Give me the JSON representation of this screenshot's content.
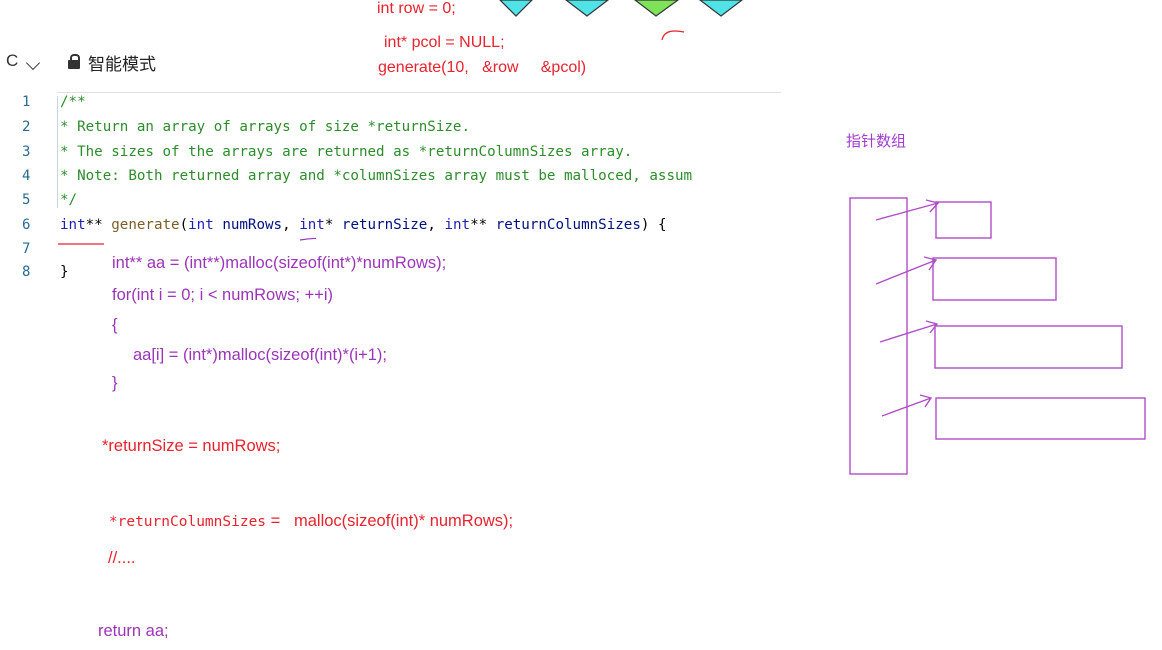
{
  "toolbar": {
    "language_button": "C",
    "mode_label": "智能模式"
  },
  "editor": {
    "line_numbers": [
      "1",
      "2",
      "3",
      "4",
      "5",
      "6",
      "7",
      "8"
    ],
    "lines": [
      {
        "parts": [
          {
            "t": "/**",
            "c": "cm"
          }
        ]
      },
      {
        "parts": [
          {
            "t": " * Return an array of arrays of size *returnSize.",
            "c": "cm"
          }
        ]
      },
      {
        "parts": [
          {
            "t": " * The sizes of the arrays are returned as *returnColumnSizes array.",
            "c": "cm"
          }
        ]
      },
      {
        "parts": [
          {
            "t": " * Note: Both returned array and *columnSizes array must be malloced, assum",
            "c": "cm"
          }
        ]
      },
      {
        "parts": [
          {
            "t": " */",
            "c": "cm"
          }
        ]
      },
      {
        "parts": [
          {
            "t": "int",
            "c": "kw"
          },
          {
            "t": "** ",
            "c": ""
          },
          {
            "t": "generate",
            "c": "fn"
          },
          {
            "t": "(",
            "c": ""
          },
          {
            "t": "int",
            "c": "kw"
          },
          {
            "t": " ",
            "c": ""
          },
          {
            "t": "numRows",
            "c": "pr"
          },
          {
            "t": ", ",
            "c": ""
          },
          {
            "t": "int",
            "c": "kw"
          },
          {
            "t": "* ",
            "c": ""
          },
          {
            "t": "returnSize",
            "c": "pr"
          },
          {
            "t": ", ",
            "c": ""
          },
          {
            "t": "int",
            "c": "kw"
          },
          {
            "t": "** ",
            "c": ""
          },
          {
            "t": "returnColumnSizes",
            "c": "pr"
          },
          {
            "t": ") {",
            "c": ""
          }
        ]
      },
      {
        "parts": []
      },
      {
        "parts": [
          {
            "t": "}",
            "c": ""
          }
        ]
      }
    ]
  },
  "annotations": {
    "top_row": "int row = 0;",
    "top_pcol": "int* pcol = NULL;",
    "top_generate": "generate(10,   &row     &pcol)",
    "line_aa": "int** aa = (int**)malloc(sizeof(int*)*numRows);",
    "line_for": "for(int i = 0; i < numRows; ++i)",
    "line_open": "{",
    "line_alloc": "aa[i] = (int*)malloc(sizeof(int)*(i+1);",
    "line_close": "}",
    "line_return_size": "*returnSize = numRows;",
    "line_rcs_code": "*returnColumnSizes",
    "line_rcs_rest": " =   malloc(sizeof(int)* numRows);",
    "line_comment": "//....",
    "line_return": "return aa;"
  },
  "diagram": {
    "title": "指针数组"
  },
  "colors": {
    "handwriting_red": "#e8222f",
    "handwriting_purple": "#9b35b8",
    "diamond_cyan": "#4fe3e8",
    "diamond_green": "#7fe35a"
  }
}
